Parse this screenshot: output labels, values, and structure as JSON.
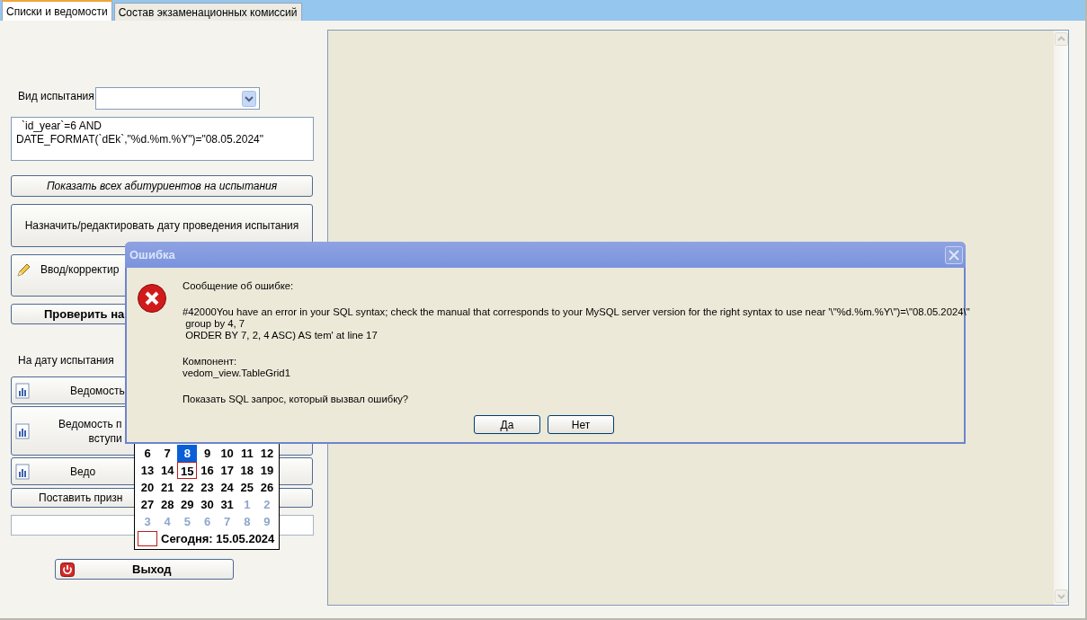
{
  "tabs": [
    {
      "label": "Списки и ведомости",
      "selected": true
    },
    {
      "label": "Состав экзаменационных комиссий",
      "selected": false
    }
  ],
  "left_panel": {
    "test_type_label": "Вид испытания",
    "filter_lines": [
      "`id_year`=6 AND",
      "DATE_FORMAT(`dEk`,\"%d.%m.%Y\")=\"08.05.2024\""
    ],
    "top_buttons": [
      {
        "kind": "italic",
        "lines": [
          "Показать всех абитуриентов на испытания"
        ]
      },
      {
        "kind": "plain",
        "lines": [
          "Назначить/редактировать дату проведения испытания"
        ]
      },
      {
        "kind": "pencil",
        "lines": [
          "Ввод/корректир"
        ]
      },
      {
        "kind": "bold",
        "lines": [
          "Проверить на"
        ]
      }
    ],
    "date_label": "На дату испытания",
    "bottom_buttons": [
      {
        "kind": "report",
        "lines": [
          "Ведомость"
        ]
      },
      {
        "kind": "report",
        "lines": [
          "Ведомость п",
          "вступи"
        ]
      },
      {
        "kind": "report",
        "lines": [
          "Ведо"
        ]
      },
      {
        "kind": "plain",
        "lines": [
          "Поставить призн"
        ]
      }
    ],
    "exit_button": "Выход"
  },
  "calendar": {
    "weeks": [
      [
        {
          "day": "6",
          "selected": false,
          "today": false,
          "muted": false
        },
        {
          "day": "7",
          "selected": false,
          "today": false,
          "muted": false
        },
        {
          "day": "8",
          "selected": true,
          "today": false,
          "muted": false
        },
        {
          "day": "9",
          "selected": false,
          "today": false,
          "muted": false
        },
        {
          "day": "10",
          "selected": false,
          "today": false,
          "muted": false
        },
        {
          "day": "11",
          "selected": false,
          "today": false,
          "muted": false
        },
        {
          "day": "12",
          "selected": false,
          "today": false,
          "muted": false
        }
      ],
      [
        {
          "day": "13",
          "selected": false,
          "today": false,
          "muted": false
        },
        {
          "day": "14",
          "selected": false,
          "today": false,
          "muted": false
        },
        {
          "day": "15",
          "selected": false,
          "today": true,
          "muted": false
        },
        {
          "day": "16",
          "selected": false,
          "today": false,
          "muted": false
        },
        {
          "day": "17",
          "selected": false,
          "today": false,
          "muted": false
        },
        {
          "day": "18",
          "selected": false,
          "today": false,
          "muted": false
        },
        {
          "day": "19",
          "selected": false,
          "today": false,
          "muted": false
        }
      ],
      [
        {
          "day": "20",
          "selected": false,
          "today": false,
          "muted": false
        },
        {
          "day": "21",
          "selected": false,
          "today": false,
          "muted": false
        },
        {
          "day": "22",
          "selected": false,
          "today": false,
          "muted": false
        },
        {
          "day": "23",
          "selected": false,
          "today": false,
          "muted": false
        },
        {
          "day": "24",
          "selected": false,
          "today": false,
          "muted": false
        },
        {
          "day": "25",
          "selected": false,
          "today": false,
          "muted": false
        },
        {
          "day": "26",
          "selected": false,
          "today": false,
          "muted": false
        }
      ],
      [
        {
          "day": "27",
          "selected": false,
          "today": false,
          "muted": false
        },
        {
          "day": "28",
          "selected": false,
          "today": false,
          "muted": false
        },
        {
          "day": "29",
          "selected": false,
          "today": false,
          "muted": false
        },
        {
          "day": "30",
          "selected": false,
          "today": false,
          "muted": false
        },
        {
          "day": "31",
          "selected": false,
          "today": false,
          "muted": false
        },
        {
          "day": "1",
          "selected": false,
          "today": false,
          "muted": true
        },
        {
          "day": "2",
          "selected": false,
          "today": false,
          "muted": true
        }
      ],
      [
        {
          "day": "3",
          "selected": false,
          "today": false,
          "muted": true
        },
        {
          "day": "4",
          "selected": false,
          "today": false,
          "muted": true
        },
        {
          "day": "5",
          "selected": false,
          "today": false,
          "muted": true
        },
        {
          "day": "6",
          "selected": false,
          "today": false,
          "muted": true
        },
        {
          "day": "7",
          "selected": false,
          "today": false,
          "muted": true
        },
        {
          "day": "8",
          "selected": false,
          "today": false,
          "muted": true
        },
        {
          "day": "9",
          "selected": false,
          "today": false,
          "muted": true
        }
      ]
    ],
    "today_label": "Сегодня: 15.05.2024"
  },
  "dialog": {
    "title": "Ошибка",
    "heading": "Сообщение об ошибке:",
    "error_lines": [
      "#42000You have an error in your SQL syntax; check the manual that corresponds to your MySQL server version for the right syntax to use near '\\\"%d.%m.%Y\\\")=\\\"08.05.2024\\\"",
      " group by 4, 7",
      " ORDER BY 7, 2, 4 ASC) AS tem' at line 17"
    ],
    "component_label": "Компонент:",
    "component_value": "vedom_view.TableGrid1",
    "question": "Показать SQL запрос, который вызвал ошибку?",
    "buttons": [
      "Да",
      "Нет"
    ]
  }
}
